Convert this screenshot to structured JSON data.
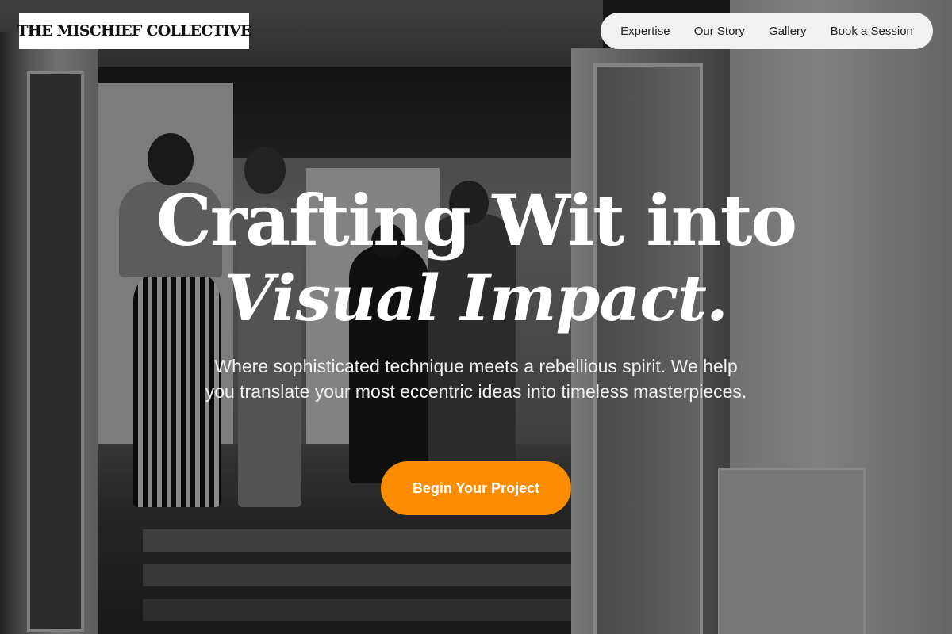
{
  "brand": {
    "name": "THE MISCHIEF COLLECTIVE"
  },
  "nav": {
    "items": [
      {
        "label": "Expertise"
      },
      {
        "label": "Our Story"
      },
      {
        "label": "Gallery"
      },
      {
        "label": "Book a Session"
      }
    ]
  },
  "hero": {
    "headline_line1": "Crafting Wit into",
    "headline_line2": "Visual Impact.",
    "subtext": "Where sophisticated technique meets a rebellious spirit. We help you translate your most eccentric ideas into timeless masterpieces.",
    "cta_label": "Begin Your Project",
    "background_image": "grayscale-photo-gallery-doorway"
  },
  "colors": {
    "accent": "#fb8c00",
    "nav_background": "#f1f1f1",
    "brand_background": "#ffffff",
    "overlay": "rgba(0,0,0,0.40)"
  }
}
